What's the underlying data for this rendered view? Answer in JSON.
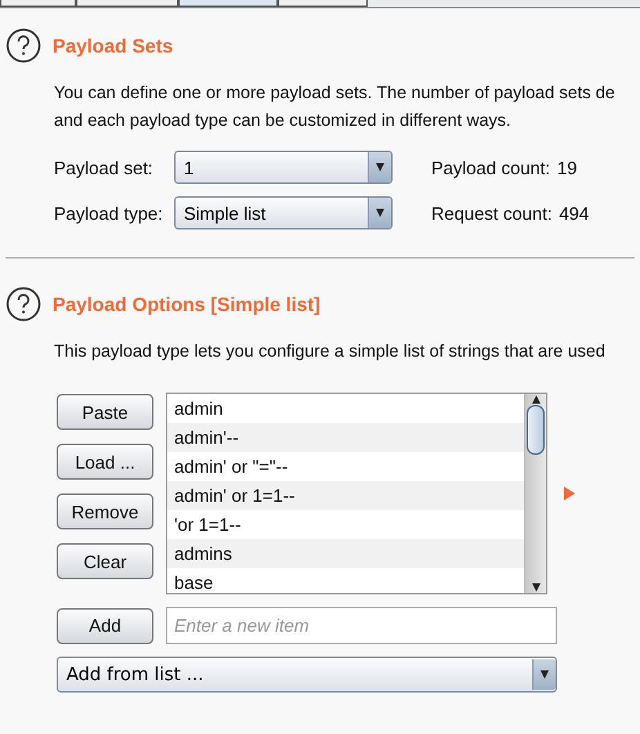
{
  "tabs": [
    {
      "selected": false
    },
    {
      "selected": false
    },
    {
      "selected": true
    },
    {
      "selected": false
    }
  ],
  "payload_sets": {
    "title": "Payload Sets",
    "description": [
      "You can define one or more payload sets. The number of payload sets de",
      "and each payload type can be customized in different ways."
    ],
    "fields": [
      {
        "label": "Payload set:",
        "value": "1",
        "info_label": "Payload count:",
        "info_value": "19"
      },
      {
        "label": "Payload type:",
        "value": "Simple list",
        "info_label": "Request count:",
        "info_value": "494"
      }
    ]
  },
  "payload_options": {
    "title": "Payload Options [Simple list]",
    "description": "This payload type lets you configure a simple list of strings that are used",
    "buttons": [
      "Paste",
      "Load ...",
      "Remove",
      "Clear"
    ],
    "items": [
      "admin",
      "admin'--",
      "admin' or \"=\"--",
      "admin' or 1=1--",
      "'or 1=1--",
      "admins",
      "base"
    ],
    "add_button": "Add",
    "new_item": {
      "placeholder": "Enter a new item"
    },
    "add_from_list": "Add from list ..."
  }
}
